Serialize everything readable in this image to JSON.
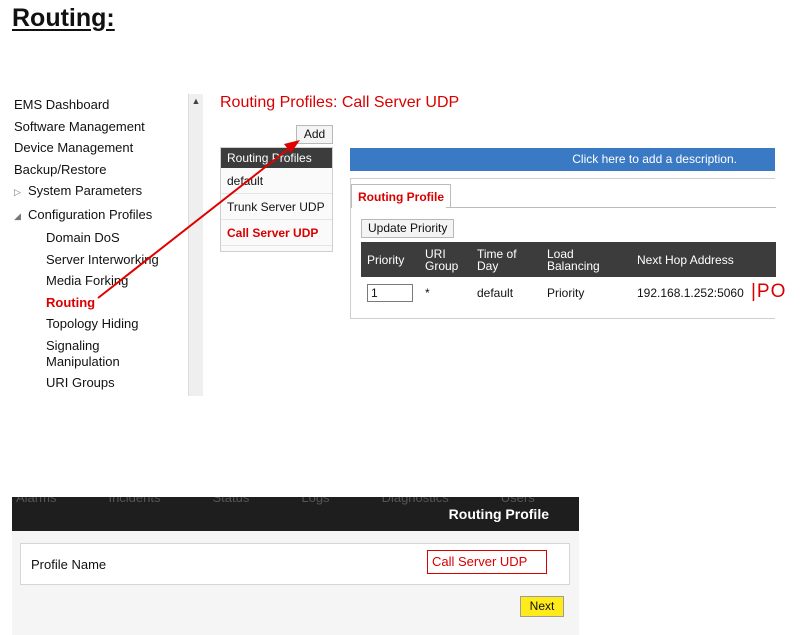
{
  "doc_heading": "Routing:",
  "nav": {
    "items": {
      "ems_dashboard": "EMS Dashboard",
      "software_management": "Software Management",
      "device_management": "Device Management",
      "backup_restore": "Backup/Restore",
      "system_parameters": "System Parameters",
      "configuration_profiles": "Configuration Profiles",
      "domain_dos": "Domain DoS",
      "server_interworking": "Server Interworking",
      "media_forking": "Media Forking",
      "routing": "Routing",
      "topology_hiding": "Topology Hiding",
      "signaling_manipulation": "Signaling Manipulation",
      "uri_groups": "URI Groups"
    },
    "icons": {
      "collapsed": "triangle-right-icon",
      "expanded": "triangle-down-icon",
      "scroll_up": "chevron-up-icon"
    }
  },
  "page_title": "Routing Profiles: Call Server UDP",
  "add_label": "Add",
  "profiles": {
    "header": "Routing Profiles",
    "items": [
      "default",
      "Trunk Server UDP",
      "Call Server UDP"
    ],
    "selected": "Call Server UDP"
  },
  "description_bar": "Click here to add a description.",
  "tab_label": "Routing Profile",
  "update_priority_label": "Update Priority",
  "hop_table": {
    "headers": [
      "Priority",
      "URI Group",
      "Time of Day",
      "Load Balancing",
      "Next Hop Address"
    ],
    "row": {
      "priority": "1",
      "uri_group": "*",
      "time_of_day": "default",
      "load_balancing": "Priority",
      "next_hop_address": "192.168.1.252:5060",
      "overflow_text": "|PO"
    }
  },
  "shot2": {
    "menu_ghost": [
      "Alarms",
      "Incidents",
      "Status",
      "Logs",
      "Diagnostics",
      "Users"
    ],
    "title": "Routing Profile",
    "profile_name_label": "Profile Name",
    "profile_name_value": "Call Server UDP",
    "next_label": "Next"
  },
  "colors": {
    "accent_red": "#d90000",
    "header_dark": "#3c3c3c",
    "description_blue": "#3a79c4",
    "next_yellow": "#ffeb1a",
    "annotation_arrow": "#e00000"
  }
}
